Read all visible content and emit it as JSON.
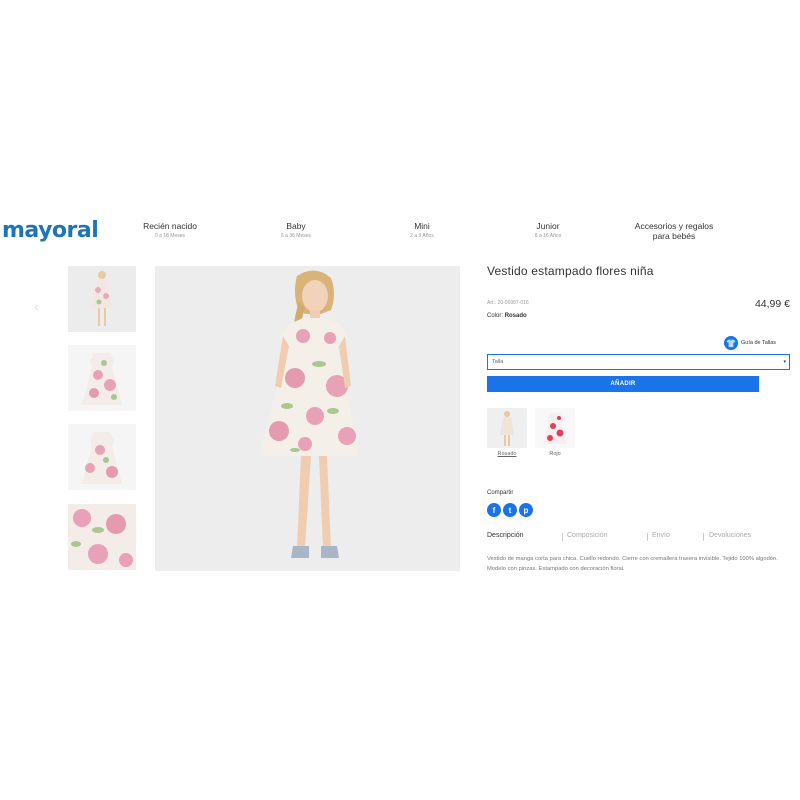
{
  "header": {
    "logo": "mayoral",
    "nav": [
      {
        "title": "Recién nacido",
        "sub": "0 a 18 Meses"
      },
      {
        "title": "Baby",
        "sub": "6 a 36 Meses"
      },
      {
        "title": "Mini",
        "sub": "2 a 9 Años"
      },
      {
        "title": "Junior",
        "sub": "8 a 16 Años"
      },
      {
        "title": "Accesorios y regalos",
        "title2": "para bebés"
      }
    ]
  },
  "product": {
    "title": "Vestido estampado flores niña",
    "art": "Art.: 20-06987-016",
    "price": "44,99 €",
    "color_label": "Color:",
    "color_value": "Rosado",
    "size_guide": "Guía de Tallas",
    "size_placeholder": "Talla",
    "add_button": "AÑADIR",
    "swatches": [
      {
        "label": "Rosado"
      },
      {
        "label": "Rojo"
      }
    ],
    "share_label": "Compartir",
    "share_icons": [
      "facebook-icon",
      "twitter-icon",
      "pinterest-icon"
    ],
    "tabs": [
      "Descripción",
      "Composición",
      "Envío",
      "Devoluciones"
    ],
    "description": "Vestido de manga corta para chica. Cuello redondo. Cierre con cremallera trasera invisible. Tejido 100% algodón. Modelo con pinzas. Estampado con decoración floral."
  },
  "colors": {
    "brand": "#1d74b9",
    "accent": "#1a73e8"
  }
}
